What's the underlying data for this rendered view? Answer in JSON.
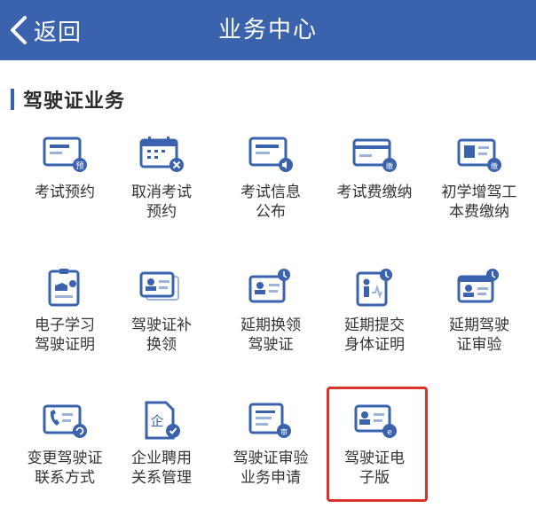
{
  "header": {
    "back_label": "返回",
    "title": "业务中心"
  },
  "section": {
    "title": "驾驶证业务"
  },
  "items": [
    {
      "label": "考试预约",
      "icon": "exam-booking-icon"
    },
    {
      "label": "取消考试\n预约",
      "icon": "cancel-exam-icon"
    },
    {
      "label": "考试信息\n公布",
      "icon": "exam-info-icon"
    },
    {
      "label": "考试费缴纳",
      "icon": "exam-fee-icon"
    },
    {
      "label": "初学增驾工\n本费缴纳",
      "icon": "fee-payment-icon"
    },
    {
      "label": "电子学习\n驾驶证明",
      "icon": "e-learning-certificate-icon"
    },
    {
      "label": "驾驶证补\n换领",
      "icon": "license-reissue-icon"
    },
    {
      "label": "延期换领\n驾驶证",
      "icon": "extend-renewal-icon"
    },
    {
      "label": "延期提交\n身体证明",
      "icon": "health-proof-icon"
    },
    {
      "label": "延期驾驶\n证审验",
      "icon": "extend-review-icon"
    },
    {
      "label": "变更驾驶证\n联系方式",
      "icon": "contact-change-icon"
    },
    {
      "label": "企业聘用\n关系管理",
      "icon": "enterprise-icon"
    },
    {
      "label": "驾驶证审验\n业务申请",
      "icon": "review-application-icon"
    },
    {
      "label": "驾驶证电\n子版",
      "icon": "e-license-icon"
    }
  ],
  "colors": {
    "header": "#3a62ad",
    "icon_blue": "#3a62ad",
    "highlight": "#d9312b"
  }
}
